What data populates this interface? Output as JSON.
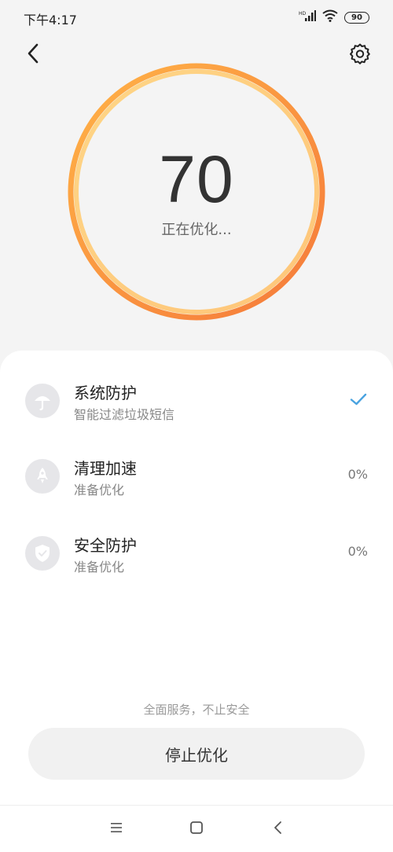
{
  "status_bar": {
    "time": "下午4:17",
    "battery": "90",
    "icons": [
      "hd-signal-icon",
      "wifi-icon",
      "battery-icon"
    ]
  },
  "header": {
    "back_icon": "back-arrow-icon",
    "settings_icon": "gear-icon"
  },
  "progress": {
    "score": "70",
    "status": "正在优化...",
    "ring_colors": {
      "outer": "#f58a3b",
      "inner": "#ffc56b"
    }
  },
  "items": [
    {
      "title": "系统防护",
      "subtitle": "智能过滤垃圾短信",
      "status": "",
      "done": true,
      "icon": "umbrella-icon"
    },
    {
      "title": "清理加速",
      "subtitle": "准备优化",
      "status": "0%",
      "done": false,
      "icon": "rocket-icon"
    },
    {
      "title": "安全防护",
      "subtitle": "准备优化",
      "status": "0%",
      "done": false,
      "icon": "shield-icon"
    }
  ],
  "footer": {
    "note": "全面服务，不止安全",
    "stop_label": "停止优化"
  },
  "colors": {
    "check": "#4aa3e0",
    "icon_bg": "#e6e6e9"
  }
}
